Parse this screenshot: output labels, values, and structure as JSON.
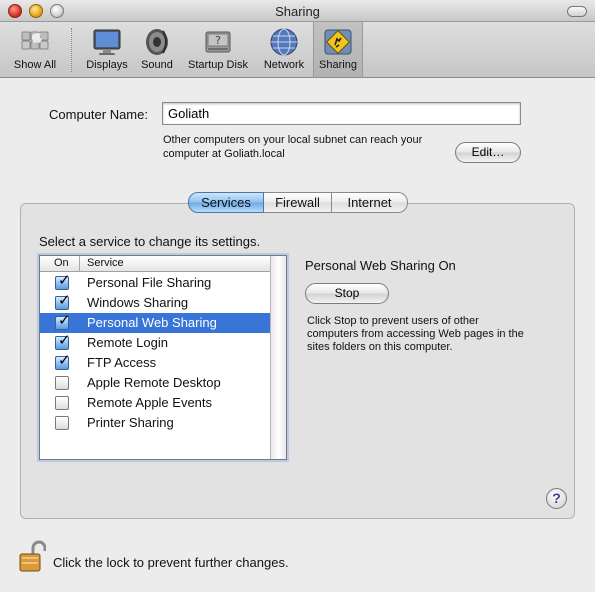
{
  "window": {
    "title": "Sharing"
  },
  "toolbar": {
    "items": [
      {
        "label": "Show All",
        "icon": "apple-icon"
      },
      {
        "label": "Displays",
        "icon": "display-icon"
      },
      {
        "label": "Sound",
        "icon": "speaker-icon"
      },
      {
        "label": "Startup Disk",
        "icon": "disk-icon"
      },
      {
        "label": "Network",
        "icon": "globe-icon"
      },
      {
        "label": "Sharing",
        "icon": "sharing-icon",
        "selected": true
      }
    ]
  },
  "computer_name": {
    "label": "Computer Name:",
    "value": "Goliath",
    "help_line1": "Other computers on your local subnet can reach your",
    "help_line2": "computer at Goliath.local",
    "edit_label": "Edit…"
  },
  "tabs": [
    {
      "label": "Services",
      "active": true
    },
    {
      "label": "Firewall",
      "active": false
    },
    {
      "label": "Internet",
      "active": false
    }
  ],
  "services": {
    "instruction": "Select a service to change its settings.",
    "col_on": "On",
    "col_service": "Service",
    "rows": [
      {
        "name": "Personal File Sharing",
        "on": true,
        "selected": false
      },
      {
        "name": "Windows Sharing",
        "on": true,
        "selected": false
      },
      {
        "name": "Personal Web Sharing",
        "on": true,
        "selected": true
      },
      {
        "name": "Remote Login",
        "on": true,
        "selected": false
      },
      {
        "name": "FTP Access",
        "on": true,
        "selected": false
      },
      {
        "name": "Apple Remote Desktop",
        "on": false,
        "selected": false
      },
      {
        "name": "Remote Apple Events",
        "on": false,
        "selected": false
      },
      {
        "name": "Printer Sharing",
        "on": false,
        "selected": false
      }
    ]
  },
  "status": {
    "title": "Personal Web Sharing On",
    "button_label": "Stop",
    "desc_line1": "Click Stop to prevent users of other",
    "desc_line2": "computers from accessing Web pages in the",
    "desc_line3": "sites folders on this computer."
  },
  "help": {
    "label": "?"
  },
  "lock": {
    "text": "Click the lock to prevent further changes."
  },
  "colors": {
    "selection": "#3875d7",
    "tab_active": "#8fc1ee"
  }
}
